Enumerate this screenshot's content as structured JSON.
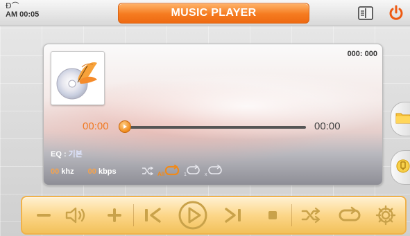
{
  "status": {
    "signal_glyph": "Ð⌒",
    "time": "AM 00:05"
  },
  "header": {
    "title": "MUSIC PLAYER"
  },
  "track": {
    "counter": "000: 000",
    "current_time": "00:00",
    "total_time": "00:00",
    "progress": 0,
    "eq_label": "EQ : ",
    "eq_value": "기본",
    "khz_value": "00",
    "khz_unit": " khz",
    "kbps_value": "00",
    "kbps_unit": " kbps",
    "repeat_all_badge": "All",
    "repeat_one_badge": "1",
    "repeat_x_badge": "x"
  },
  "colors": {
    "accent": "#f57b20",
    "bar": "#fcd689",
    "icon": "#c9a24a"
  },
  "icons": [
    "signal-icon",
    "split-screen-icon",
    "power-icon",
    "album-art-icon",
    "folder-icon",
    "usb-icon",
    "minus-icon",
    "speaker-icon",
    "plus-icon",
    "previous-icon",
    "play-icon",
    "next-icon",
    "stop-icon",
    "shuffle-icon",
    "repeat-icon",
    "settings-icon"
  ]
}
